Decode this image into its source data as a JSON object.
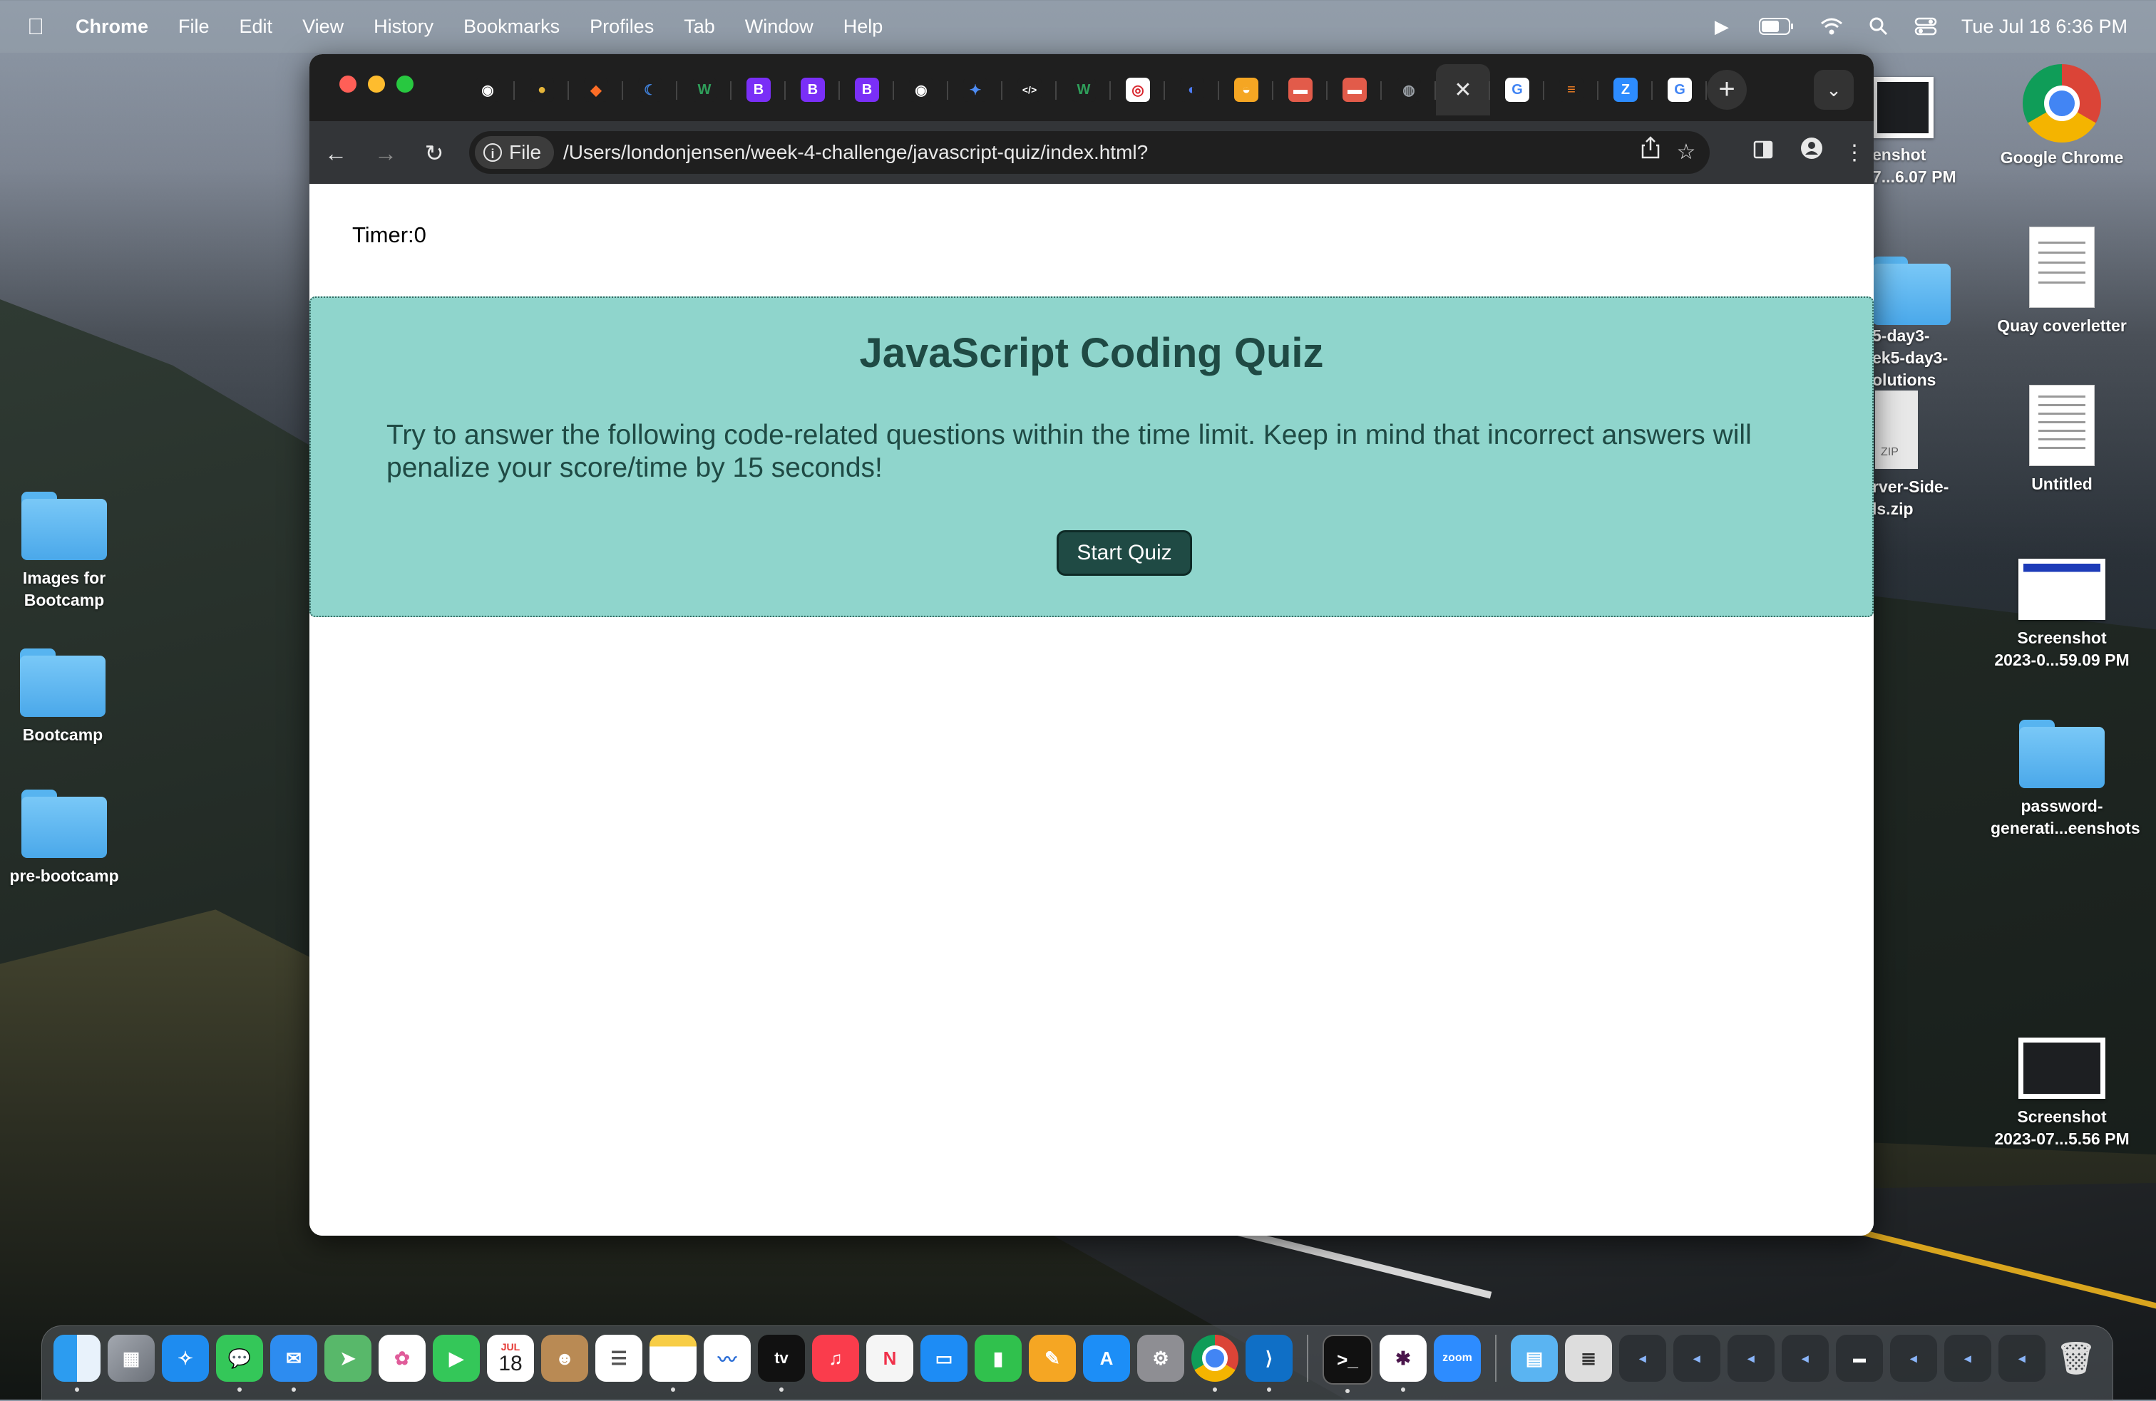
{
  "menubar": {
    "app": "Chrome",
    "items": [
      "File",
      "Edit",
      "View",
      "History",
      "Bookmarks",
      "Profiles",
      "Tab",
      "Window",
      "Help"
    ],
    "clock": "Tue Jul 18  6:36 PM"
  },
  "desktop_left": [
    {
      "label_line1": "Images for",
      "label_line2": "Bootcamp"
    },
    {
      "label_line1": "Bootcamp",
      "label_line2": ""
    },
    {
      "label_line1": "pre-bootcamp",
      "label_line2": ""
    }
  ],
  "desktop_right": {
    "chrome_label": "Google Chrome",
    "shot_partial_1": "enshot",
    "shot_partial_2": "7...6.07 PM",
    "coverletter": "Quay coverletter",
    "folder_partial_1": "5-day3-",
    "folder_partial_2": "ek5-day3-",
    "folder_partial_3": "olutions",
    "zip_partial_1": "rver-Side-",
    "zip_partial_2": "ls.zip",
    "zip_tag": "ZIP",
    "untitled": "Untitled",
    "shot1_line1": "Screenshot",
    "shot1_line2": "2023-0...59.09 PM",
    "pwfolder_line1": "password-",
    "pwfolder_line2": "generati...eenshots",
    "shot2_line1": "Screenshot",
    "shot2_line2": "2023-07...5.56 PM",
    "shot3_partial": "Screenshot"
  },
  "browser": {
    "tabs": [
      {
        "icon": "github-icon",
        "glyph": "◉",
        "bg": "#1f1f1f"
      },
      {
        "icon": "coin-icon",
        "glyph": "●",
        "bg": "#1f1f1f",
        "color": "#e5b53a"
      },
      {
        "icon": "gitlab-icon",
        "glyph": "◆",
        "bg": "#1f1f1f",
        "color": "#fc6d26"
      },
      {
        "icon": "moon-icon",
        "glyph": "☾",
        "bg": "#1f1f1f",
        "color": "#3f7fd6"
      },
      {
        "icon": "w-icon",
        "glyph": "W",
        "bg": "#1f1f1f",
        "color": "#2f9e5a"
      },
      {
        "icon": "bootstrap-icon",
        "glyph": "B",
        "bg": "#7a2ff7"
      },
      {
        "icon": "bootstrap-icon",
        "glyph": "B",
        "bg": "#7a2ff7"
      },
      {
        "icon": "bootstrap-icon",
        "glyph": "B",
        "bg": "#7a2ff7"
      },
      {
        "icon": "github-icon",
        "glyph": "◉",
        "bg": "#1f1f1f"
      },
      {
        "icon": "figma-icon",
        "glyph": "✦",
        "bg": "#1f1f1f",
        "color": "#4d8cf5"
      },
      {
        "icon": "code-icon",
        "glyph": "</>",
        "bg": "#1f1f1f"
      },
      {
        "icon": "w-icon",
        "glyph": "W",
        "bg": "#1f1f1f",
        "color": "#2f9e5a"
      },
      {
        "icon": "target-icon",
        "glyph": "◎",
        "bg": "#ffffff",
        "color": "#d8242c"
      },
      {
        "icon": "badge-icon",
        "glyph": "◐",
        "bg": "#1f1f1f",
        "color": "#4d7cf5"
      },
      {
        "icon": "shield-icon",
        "glyph": "◒",
        "bg": "#f5a623"
      },
      {
        "icon": "book-icon",
        "glyph": "▬",
        "bg": "#e25b4a"
      },
      {
        "icon": "book-icon",
        "glyph": "▬",
        "bg": "#e25b4a"
      },
      {
        "icon": "globe-icon",
        "glyph": "◍",
        "bg": "#1f1f1f",
        "color": "#9aa0a6"
      }
    ],
    "active_close": "✕",
    "tabs_after": [
      {
        "icon": "google-icon",
        "glyph": "G",
        "bg": "#ffffff",
        "color": "#4285f4"
      },
      {
        "icon": "stackoverflow-icon",
        "glyph": "≡",
        "bg": "#1f1f1f",
        "color": "#f48024"
      },
      {
        "icon": "zoom-icon",
        "glyph": "Z",
        "bg": "#2d8cff"
      },
      {
        "icon": "google-icon",
        "glyph": "G",
        "bg": "#ffffff",
        "color": "#4285f4"
      }
    ],
    "newtab": "+",
    "file_label": "File",
    "url": "/Users/londonjensen/week-4-challenge/javascript-quiz/index.html?"
  },
  "page": {
    "timer": "Timer:0",
    "title": "JavaScript Coding Quiz",
    "description": "Try to answer the following code-related questions within the time limit. Keep in mind that incorrect answers will penalize your score/time by 15 seconds!",
    "start_button": "Start Quiz"
  },
  "dock": {
    "calendar_month": "JUL",
    "calendar_day": "18",
    "tv_label": "tv",
    "zoom_label": "zoom"
  }
}
